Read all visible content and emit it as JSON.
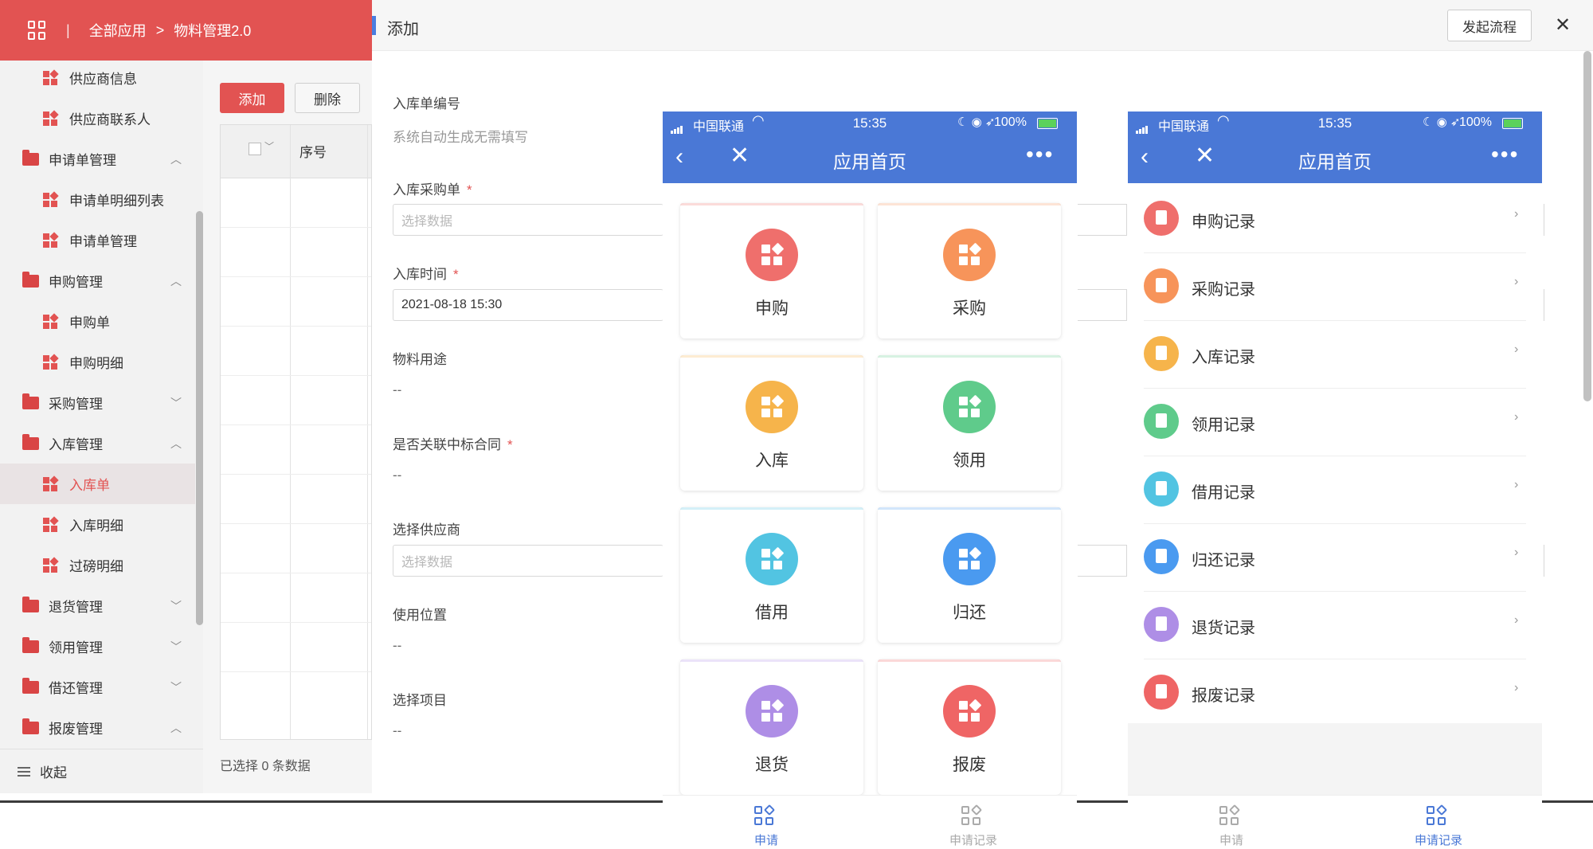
{
  "topbar": {
    "all_apps": "全部应用",
    "module": "物料管理2.0",
    "separator": "|"
  },
  "sidebar": {
    "items": [
      {
        "type": "child",
        "label": "供应商信息"
      },
      {
        "type": "child",
        "label": "供应商联系人"
      },
      {
        "type": "group",
        "label": "申请单管理",
        "arrow": "︿"
      },
      {
        "type": "child",
        "label": "申请单明细列表"
      },
      {
        "type": "child",
        "label": "申请单管理"
      },
      {
        "type": "group",
        "label": "申购管理",
        "arrow": "︿"
      },
      {
        "type": "child",
        "label": "申购单"
      },
      {
        "type": "child",
        "label": "申购明细"
      },
      {
        "type": "group",
        "label": "采购管理",
        "arrow": "﹀"
      },
      {
        "type": "group",
        "label": "入库管理",
        "arrow": "︿"
      },
      {
        "type": "child",
        "label": "入库单",
        "active": true
      },
      {
        "type": "child",
        "label": "入库明细"
      },
      {
        "type": "child",
        "label": "过磅明细"
      },
      {
        "type": "group",
        "label": "退货管理",
        "arrow": "﹀"
      },
      {
        "type": "group",
        "label": "领用管理",
        "arrow": "﹀"
      },
      {
        "type": "group",
        "label": "借还管理",
        "arrow": "﹀"
      },
      {
        "type": "group",
        "label": "报废管理",
        "arrow": "︿"
      }
    ],
    "collapse_label": "收起"
  },
  "list": {
    "add_label": "添加",
    "delete_label": "删除",
    "col_index": "序号",
    "selected_text": "已选择 0 条数据"
  },
  "dialog": {
    "title": "添加",
    "start_flow": "发起流程",
    "close": "✕",
    "fields": {
      "no_label": "入库单编号",
      "no_value": "系统自动生成无需填写",
      "po_label": "入库采购单",
      "po_placeholder": "选择数据",
      "time_label": "入库时间",
      "time_value": "2021-08-18 15:30",
      "usage_label": "物料用途",
      "usage_value": "--",
      "contract_label": "是否关联中标合同",
      "contract_value": "--",
      "supplier_label": "选择供应商",
      "supplier_placeholder": "选择数据",
      "location_label": "使用位置",
      "location_value": "--",
      "project_label": "选择项目",
      "project_value": "--",
      "required_mark": "*"
    }
  },
  "phone": {
    "carrier": "中国联通",
    "time": "15:35",
    "battery": "100%",
    "title": "应用首页",
    "more": "•••",
    "tiles": [
      {
        "label": "申购",
        "color": "#ef6f6c"
      },
      {
        "label": "采购",
        "color": "#f7945a"
      },
      {
        "label": "入库",
        "color": "#f6b44b"
      },
      {
        "label": "领用",
        "color": "#5fcb8b"
      },
      {
        "label": "借用",
        "color": "#52c4e2"
      },
      {
        "label": "归还",
        "color": "#4a9af0"
      },
      {
        "label": "退货",
        "color": "#ae8ee6"
      },
      {
        "label": "报废",
        "color": "#ef6565"
      }
    ],
    "records": [
      {
        "label": "申购记录",
        "color": "#ef6f6c"
      },
      {
        "label": "采购记录",
        "color": "#f7945a"
      },
      {
        "label": "入库记录",
        "color": "#f6b44b"
      },
      {
        "label": "领用记录",
        "color": "#5fcb8b"
      },
      {
        "label": "借用记录",
        "color": "#52c4e2"
      },
      {
        "label": "归还记录",
        "color": "#4a9af0"
      },
      {
        "label": "退货记录",
        "color": "#ae8ee6"
      },
      {
        "label": "报废记录",
        "color": "#ef6565"
      }
    ],
    "tab_apply": "申请",
    "tab_records": "申请记录",
    "accent": "#4a78d6"
  }
}
